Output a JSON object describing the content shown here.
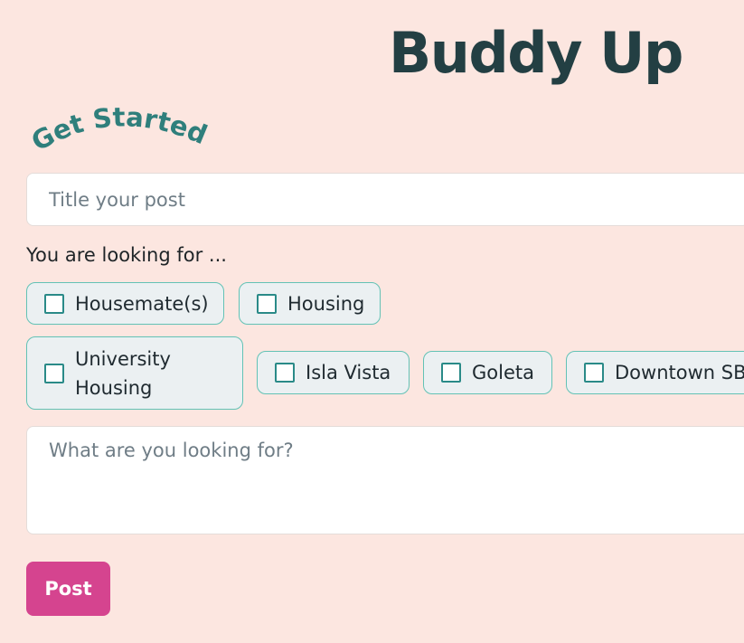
{
  "app": {
    "title": "Buddy Up",
    "tagline": "Get Started!"
  },
  "form": {
    "title_input": {
      "value": "",
      "placeholder": "Title your post"
    },
    "looking_for_label": "You are looking for ...",
    "options": [
      {
        "label": "Housemate(s)",
        "checked": false
      },
      {
        "label": "Housing",
        "checked": false
      },
      {
        "label": "University Housing",
        "checked": false
      },
      {
        "label": "Isla Vista",
        "checked": false
      },
      {
        "label": "Goleta",
        "checked": false
      },
      {
        "label": "Downtown SB",
        "checked": false
      }
    ],
    "details_input": {
      "value": "",
      "placeholder": "What are you looking for?"
    },
    "submit_label": "Post"
  },
  "colors": {
    "background": "#fce6e0",
    "title_text": "#233f43",
    "tagline_text": "#2f7f7c",
    "chip_background": "#ebf0f2",
    "chip_border": "#63c2b5",
    "checkbox_border": "#2a8a88",
    "post_button": "#d5448f"
  }
}
